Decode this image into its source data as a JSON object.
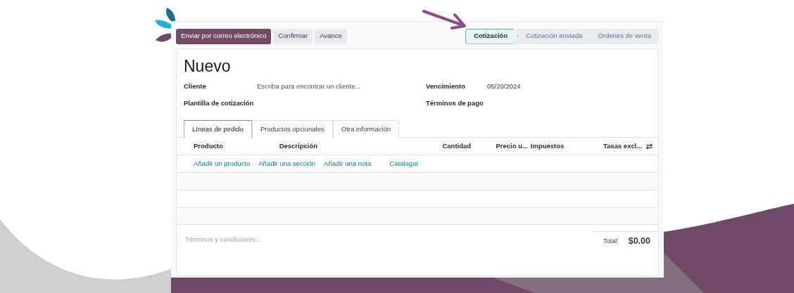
{
  "actions": [
    {
      "label": "Enviar por correo electrónico",
      "primary": true
    },
    {
      "label": "Confirmar",
      "primary": false
    },
    {
      "label": "Avance",
      "primary": false
    }
  ],
  "stages": [
    {
      "label": "Cotización",
      "selected": true
    },
    {
      "label": "Cotización enviada",
      "selected": false
    },
    {
      "label": "Órdenes de venta",
      "selected": false
    }
  ],
  "title": "Nuevo",
  "fields_left": [
    {
      "label": "Cliente",
      "placeholder": "Escriba para encontrar un cliente..."
    },
    {
      "label": "Plantilla de cotización"
    }
  ],
  "fields_right": [
    {
      "label": "Vencimiento",
      "value": "05/20/2024"
    },
    {
      "label": "Términos de pago"
    }
  ],
  "tabs": [
    {
      "label": "Líneas de pedido",
      "selected": true
    },
    {
      "label": "Productos opcionales",
      "selected": false
    },
    {
      "label": "Otra información",
      "selected": false
    }
  ],
  "table": {
    "columns": [
      "Producto",
      "Descripción",
      "Cantidad",
      "Precio u...",
      "Impuestos",
      "Tasas excl..."
    ],
    "links": [
      "Añadir un producto",
      "Añadir una sección",
      "Añadir una nota",
      "Catalogar"
    ]
  },
  "terms": {
    "placeholder": "Términos y condiciones..."
  },
  "total": {
    "label": "Total:",
    "value": "$0.00"
  }
}
